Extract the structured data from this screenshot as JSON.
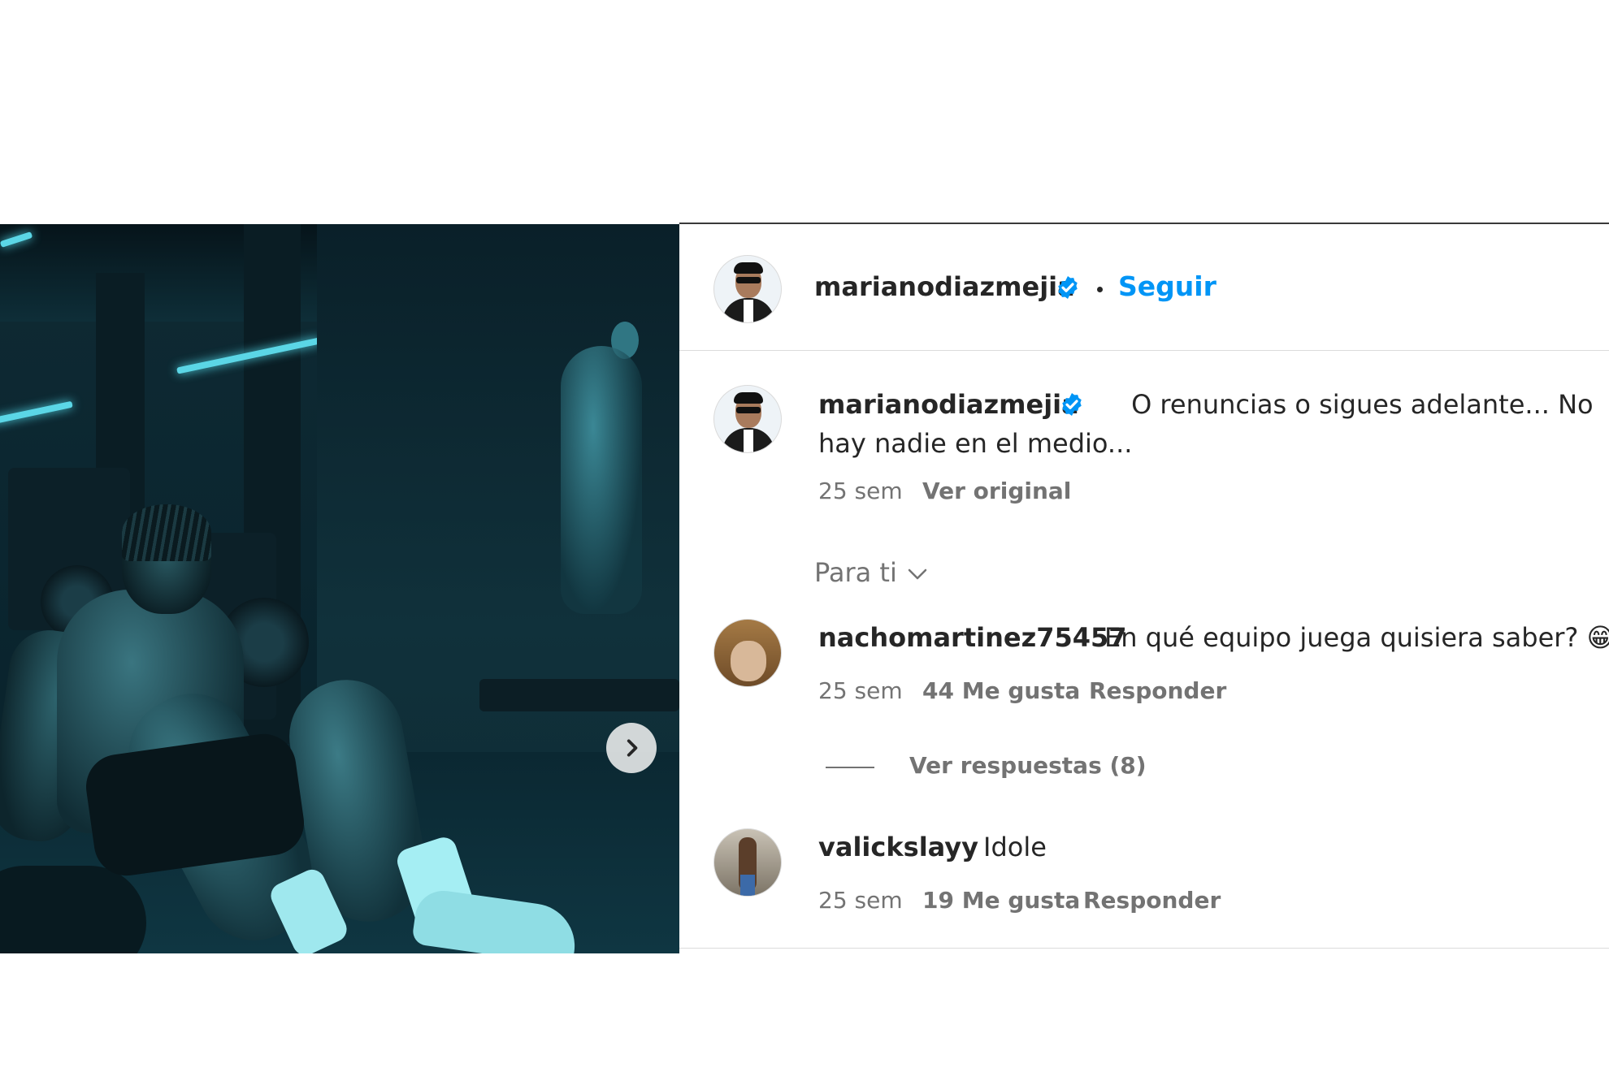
{
  "post": {
    "author": "marianodiazmejia",
    "follow_label": "Seguir",
    "caption": "O renuncias o sigues adelante... No hay nadie en el medio...",
    "caption_age": "25 sem",
    "translate_label": "Ver original"
  },
  "filter": {
    "label": "Para ti"
  },
  "comments": [
    {
      "user": "nachomartinez75457",
      "text": "En qué equipo juega quisiera saber? 😁",
      "age": "25 sem",
      "likes": "44 Me gusta",
      "reply_label": "Responder",
      "view_replies": "Ver respuestas (8)"
    },
    {
      "user": "valickslayy",
      "text": "Idole",
      "age": "25 sem",
      "likes": "19 Me gusta",
      "reply_label": "Responder"
    }
  ],
  "colors": {
    "link": "#0095f6",
    "verified": "#0095f6",
    "text": "#262626",
    "muted": "#737373"
  },
  "icons": [
    "verified-badge-icon",
    "chevron-right-icon",
    "chevron-down-icon"
  ]
}
